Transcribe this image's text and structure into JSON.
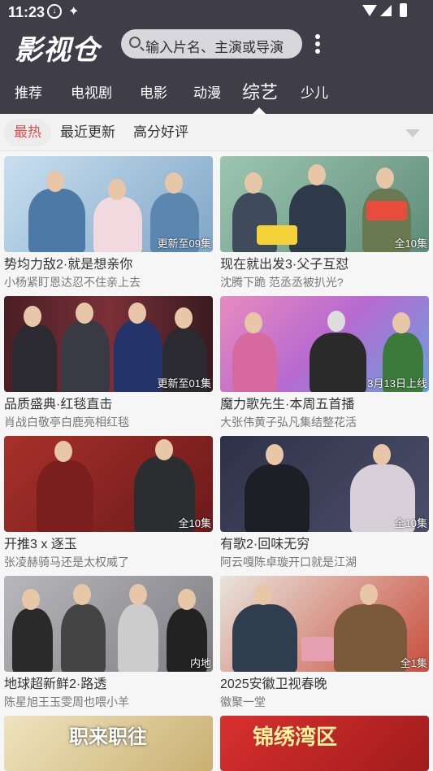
{
  "status": {
    "time": "11:23",
    "icon1": "download-icon",
    "icon2": "bug-icon"
  },
  "header": {
    "logo": "影视仓",
    "search_placeholder": "输入片名、主演或导演",
    "menu_icon": "more-vertical-icon"
  },
  "categories": [
    "推荐",
    "电视剧",
    "电影",
    "动漫",
    "综艺",
    "少儿"
  ],
  "active_category": "综艺",
  "filters": [
    "最热",
    "最近更新",
    "高分好评"
  ],
  "active_filter": "最热",
  "colors": {
    "header_bg": "#3f3d48",
    "accent": "#d9534f"
  },
  "cards": [
    {
      "title": "势均力敌2·就是想亲你",
      "subtitle": "小杨紧盯恩达忍不住亲上去",
      "badge": "更新至09集",
      "bg": "#8fb3cf"
    },
    {
      "title": "现在就出发3·父子互怼",
      "subtitle": "沈腾下跪 范丞丞被扒光?",
      "badge": "全10集",
      "bg": "#6f9a8a"
    },
    {
      "title": "品质盛典·红毯直击",
      "subtitle": "肖战白敬亭白鹿亮相红毯",
      "badge": "更新至01集",
      "bg": "#5a2630"
    },
    {
      "title": "魔力歌先生·本周五首播",
      "subtitle": "大张伟黄子弘凡集结整花活",
      "badge": "3月13日上线",
      "bg": "#c97ab0"
    },
    {
      "title": "开推3 x 逐玉",
      "subtitle": "张凌赫骑马还是太权威了",
      "badge": "全10集",
      "bg": "#8a2a2a"
    },
    {
      "title": "有歌2·回味无穷",
      "subtitle": "阿云嘎陈卓璇开口就是江湖",
      "badge": "全10集",
      "bg": "#3b3f5a"
    },
    {
      "title": "地球超新鲜2·路透",
      "subtitle": "陈星旭王玉雯周也喂小羊",
      "badge": "内地",
      "bg": "#9a9aa0"
    },
    {
      "title": "2025安徽卫视春晚",
      "subtitle": "徽聚一堂",
      "badge": "全1集",
      "bg": "#c94d3c"
    },
    {
      "title": "",
      "subtitle": "",
      "badge": "",
      "bg": "#d8c690"
    },
    {
      "title": "",
      "subtitle": "",
      "badge": "",
      "bg": "#c8262a"
    }
  ],
  "partial_texts": {
    "card9": "职来职往",
    "card10": "锦绣湾区"
  }
}
